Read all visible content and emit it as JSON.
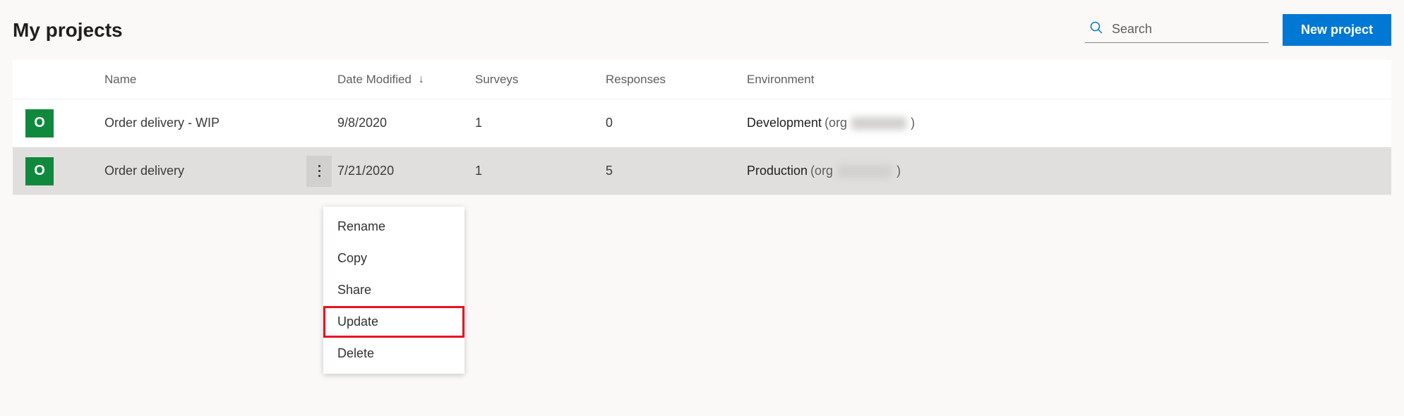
{
  "page_title": "My projects",
  "search": {
    "placeholder": "Search"
  },
  "new_project_label": "New project",
  "columns": {
    "name": "Name",
    "date_modified": "Date Modified",
    "surveys": "Surveys",
    "responses": "Responses",
    "environment": "Environment"
  },
  "sort": {
    "column": "Date Modified",
    "direction": "desc",
    "glyph": "↓"
  },
  "rows": [
    {
      "badge": "O",
      "name": "Order delivery - WIP",
      "date": "9/8/2020",
      "surveys": "1",
      "responses": "0",
      "env_name": "Development",
      "env_org_prefix": "(org",
      "env_org_suffix": ")",
      "selected": false
    },
    {
      "badge": "O",
      "name": "Order delivery",
      "date": "7/21/2020",
      "surveys": "1",
      "responses": "5",
      "env_name": "Production",
      "env_org_prefix": "(org",
      "env_org_suffix": ")",
      "selected": true
    }
  ],
  "context_menu": {
    "items": [
      {
        "label": "Rename",
        "highlighted": false
      },
      {
        "label": "Copy",
        "highlighted": false
      },
      {
        "label": "Share",
        "highlighted": false
      },
      {
        "label": "Update",
        "highlighted": true
      },
      {
        "label": "Delete",
        "highlighted": false
      }
    ]
  }
}
